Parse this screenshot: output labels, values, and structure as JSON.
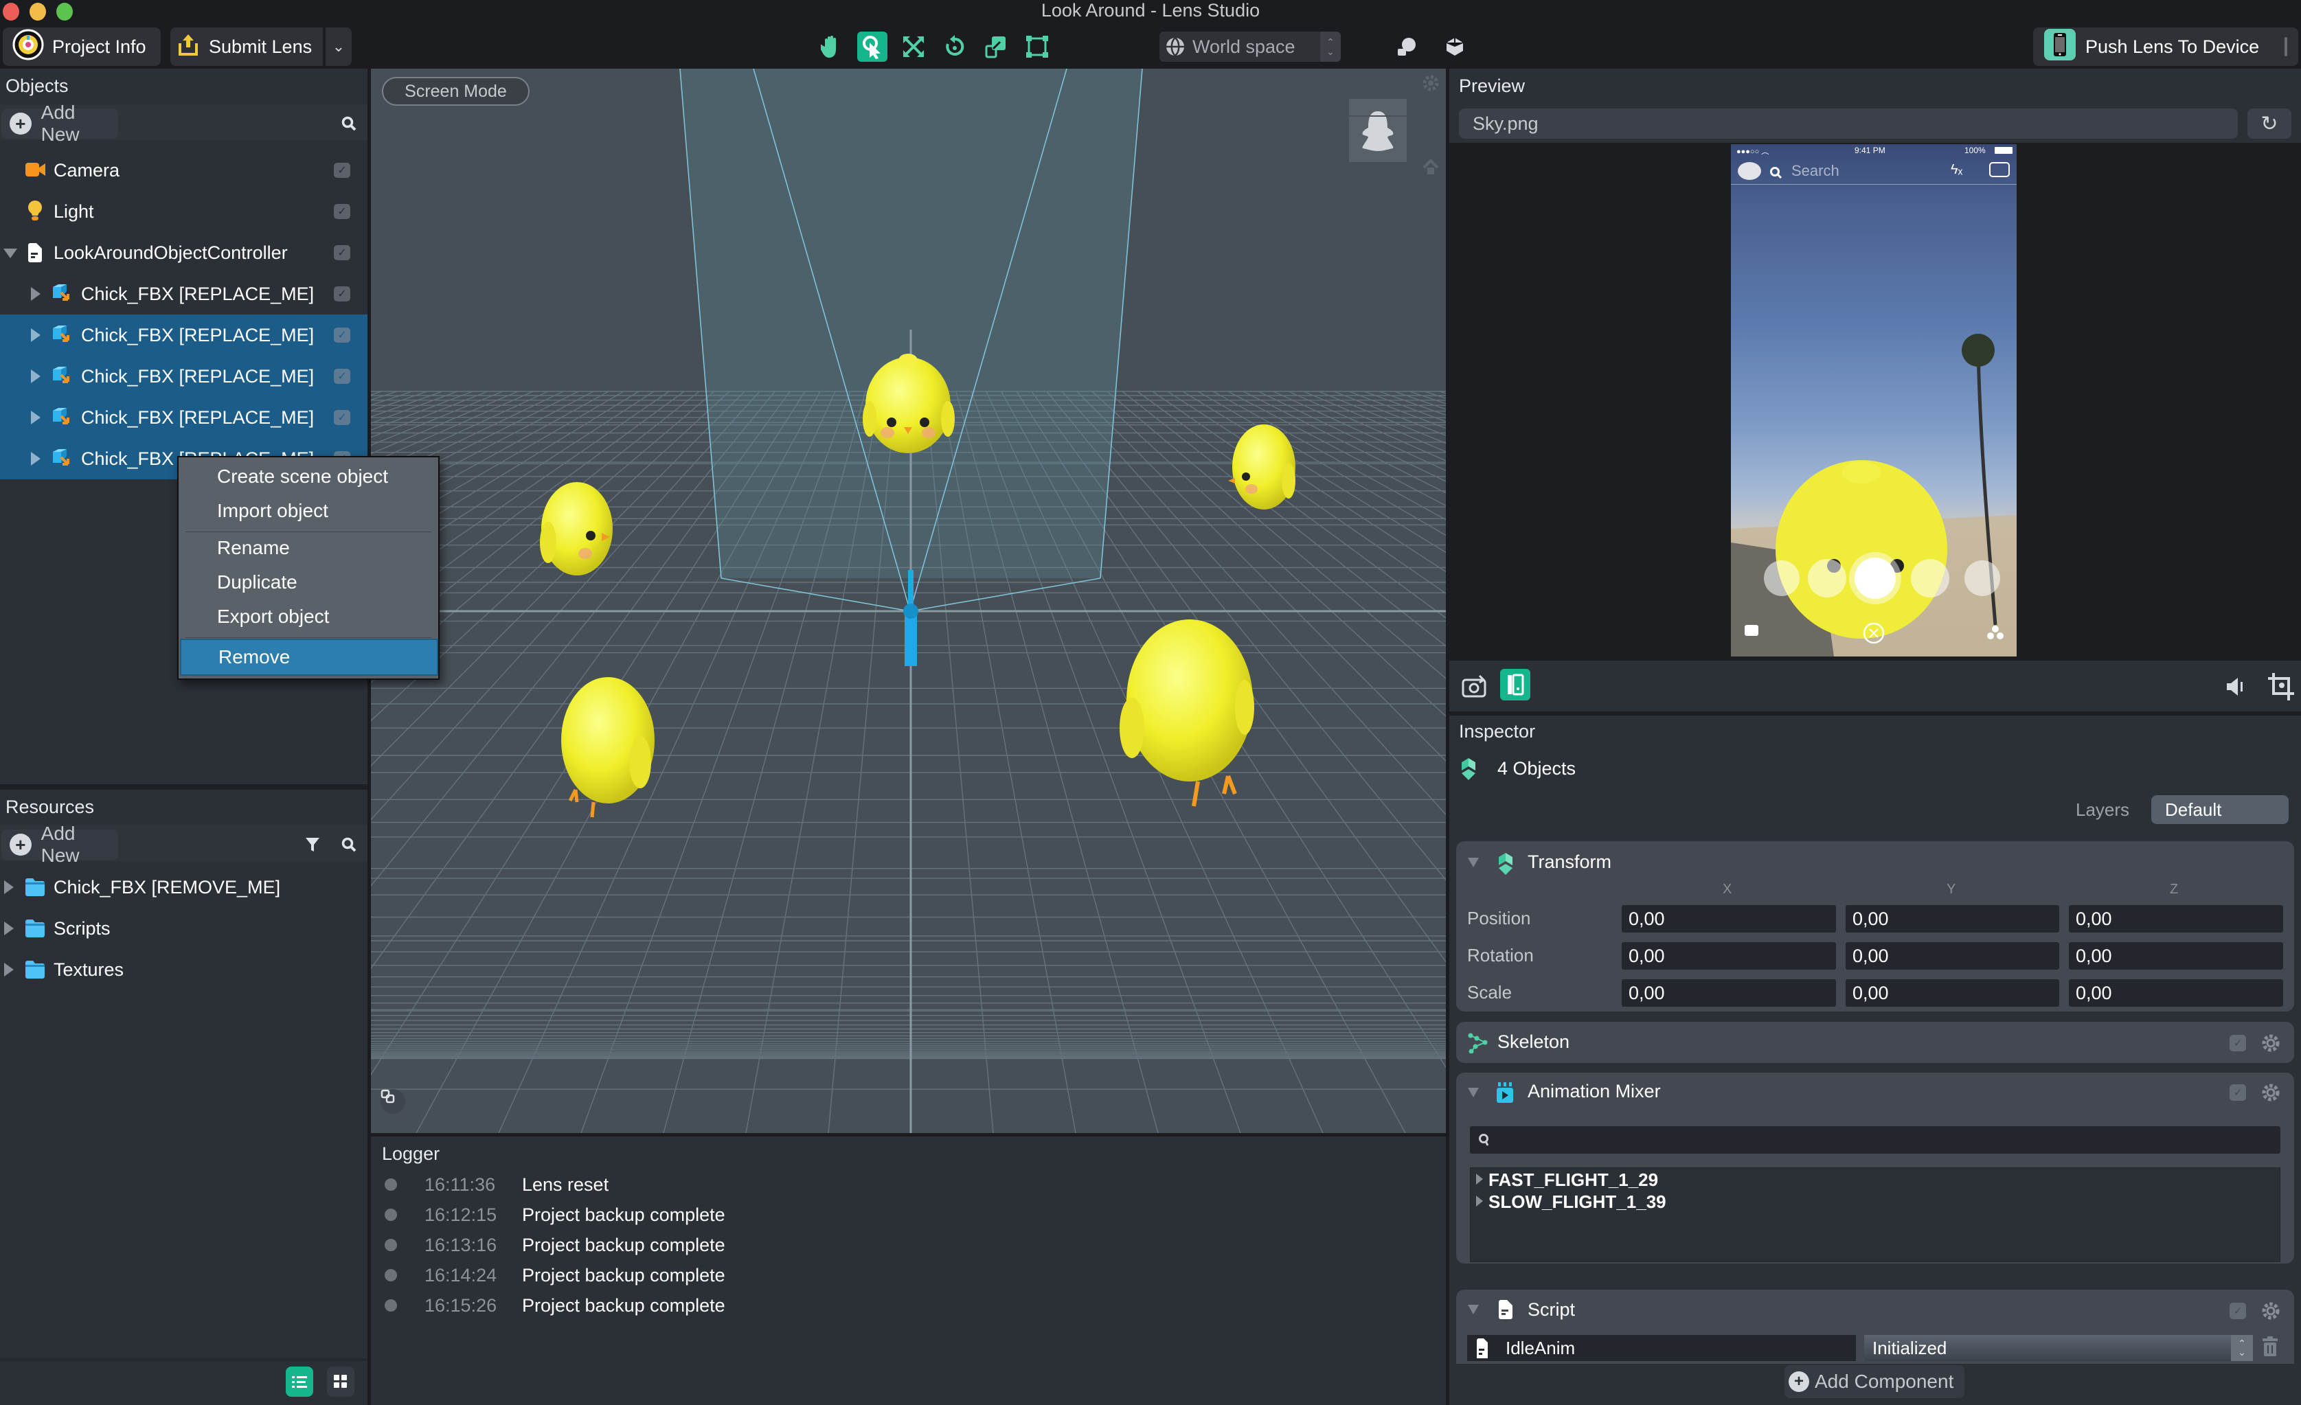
{
  "window": {
    "title": "Look Around - Lens Studio"
  },
  "toolbar": {
    "project_info_label": "Project Info",
    "submit_lens_label": "Submit Lens",
    "space_select_value": "World space",
    "push_lens_label": "Push Lens To Device",
    "tools": [
      {
        "name": "hand-tool",
        "active": false
      },
      {
        "name": "select-tool",
        "active": true
      },
      {
        "name": "move-tool",
        "active": false
      },
      {
        "name": "rotate-tool",
        "active": false
      },
      {
        "name": "scale-tool",
        "active": false
      },
      {
        "name": "rect-tool",
        "active": false
      }
    ],
    "accent_color": "#16b68d"
  },
  "objects": {
    "title": "Objects",
    "add_new_label": "Add New",
    "items": [
      {
        "label": "Camera",
        "icon": "camera-icon",
        "depth": 0,
        "expander": "none",
        "selected": false
      },
      {
        "label": "Light",
        "icon": "light-bulb-icon",
        "depth": 0,
        "expander": "none",
        "selected": false
      },
      {
        "label": "LookAroundObjectController",
        "icon": "script-icon",
        "depth": 0,
        "expander": "expanded",
        "selected": false
      },
      {
        "label": "Chick_FBX [REPLACE_ME]",
        "icon": "mesh-object-icon",
        "depth": 1,
        "expander": "collapsed",
        "selected": false
      },
      {
        "label": "Chick_FBX [REPLACE_ME]",
        "icon": "mesh-object-icon",
        "depth": 1,
        "expander": "collapsed",
        "selected": true
      },
      {
        "label": "Chick_FBX [REPLACE_ME]",
        "icon": "mesh-object-icon",
        "depth": 1,
        "expander": "collapsed",
        "selected": true
      },
      {
        "label": "Chick_FBX [REPLACE_ME]",
        "icon": "mesh-object-icon",
        "depth": 1,
        "expander": "collapsed",
        "selected": true
      },
      {
        "label": "Chick_FBX [REPLACE_ME]",
        "icon": "mesh-object-icon",
        "depth": 1,
        "expander": "collapsed",
        "selected": true
      }
    ]
  },
  "context_menu": {
    "items": [
      {
        "label": "Create scene object",
        "highlighted": false
      },
      {
        "label": "Import object",
        "highlighted": false
      },
      {
        "label": "Rename",
        "highlighted": false
      },
      {
        "label": "Duplicate",
        "highlighted": false
      },
      {
        "label": "Export object",
        "highlighted": false
      },
      {
        "label": "Remove",
        "highlighted": true
      }
    ]
  },
  "resources": {
    "title": "Resources",
    "add_new_label": "Add New",
    "items": [
      {
        "label": "Chick_FBX [REMOVE_ME]",
        "icon": "folder-icon"
      },
      {
        "label": "Scripts",
        "icon": "folder-icon"
      },
      {
        "label": "Textures",
        "icon": "folder-icon"
      }
    ]
  },
  "viewport": {
    "screen_mode_label": "Screen Mode"
  },
  "logger": {
    "title": "Logger",
    "entries": [
      {
        "time": "16:11:36",
        "message": "Lens reset"
      },
      {
        "time": "16:12:15",
        "message": "Project backup complete"
      },
      {
        "time": "16:13:16",
        "message": "Project backup complete"
      },
      {
        "time": "16:14:24",
        "message": "Project backup complete"
      },
      {
        "time": "16:15:26",
        "message": "Project backup complete"
      }
    ]
  },
  "preview": {
    "title": "Preview",
    "file": "Sky.png",
    "phone": {
      "status_time": "9:41 PM",
      "battery": "100%",
      "search_placeholder": "Search"
    }
  },
  "inspector": {
    "title": "Inspector",
    "selection_label": "4 Objects",
    "layers_label": "Layers",
    "layers_value": "Default",
    "transform": {
      "title": "Transform",
      "axes": [
        "X",
        "Y",
        "Z"
      ],
      "rows": [
        {
          "label": "Position",
          "values": [
            "0,00",
            "0,00",
            "0,00"
          ]
        },
        {
          "label": "Rotation",
          "values": [
            "0,00",
            "0,00",
            "0,00"
          ]
        },
        {
          "label": "Scale",
          "values": [
            "0,00",
            "0,00",
            "0,00"
          ]
        }
      ]
    },
    "skeleton": {
      "title": "Skeleton"
    },
    "animation_mixer": {
      "title": "Animation Mixer",
      "search_value": "",
      "layers": [
        "FAST_FLIGHT_1_29",
        "SLOW_FLIGHT_1_39"
      ]
    },
    "script": {
      "title": "Script",
      "script_name": "IdleAnim",
      "event_value": "Initialized"
    },
    "add_component_label": "Add Component"
  }
}
